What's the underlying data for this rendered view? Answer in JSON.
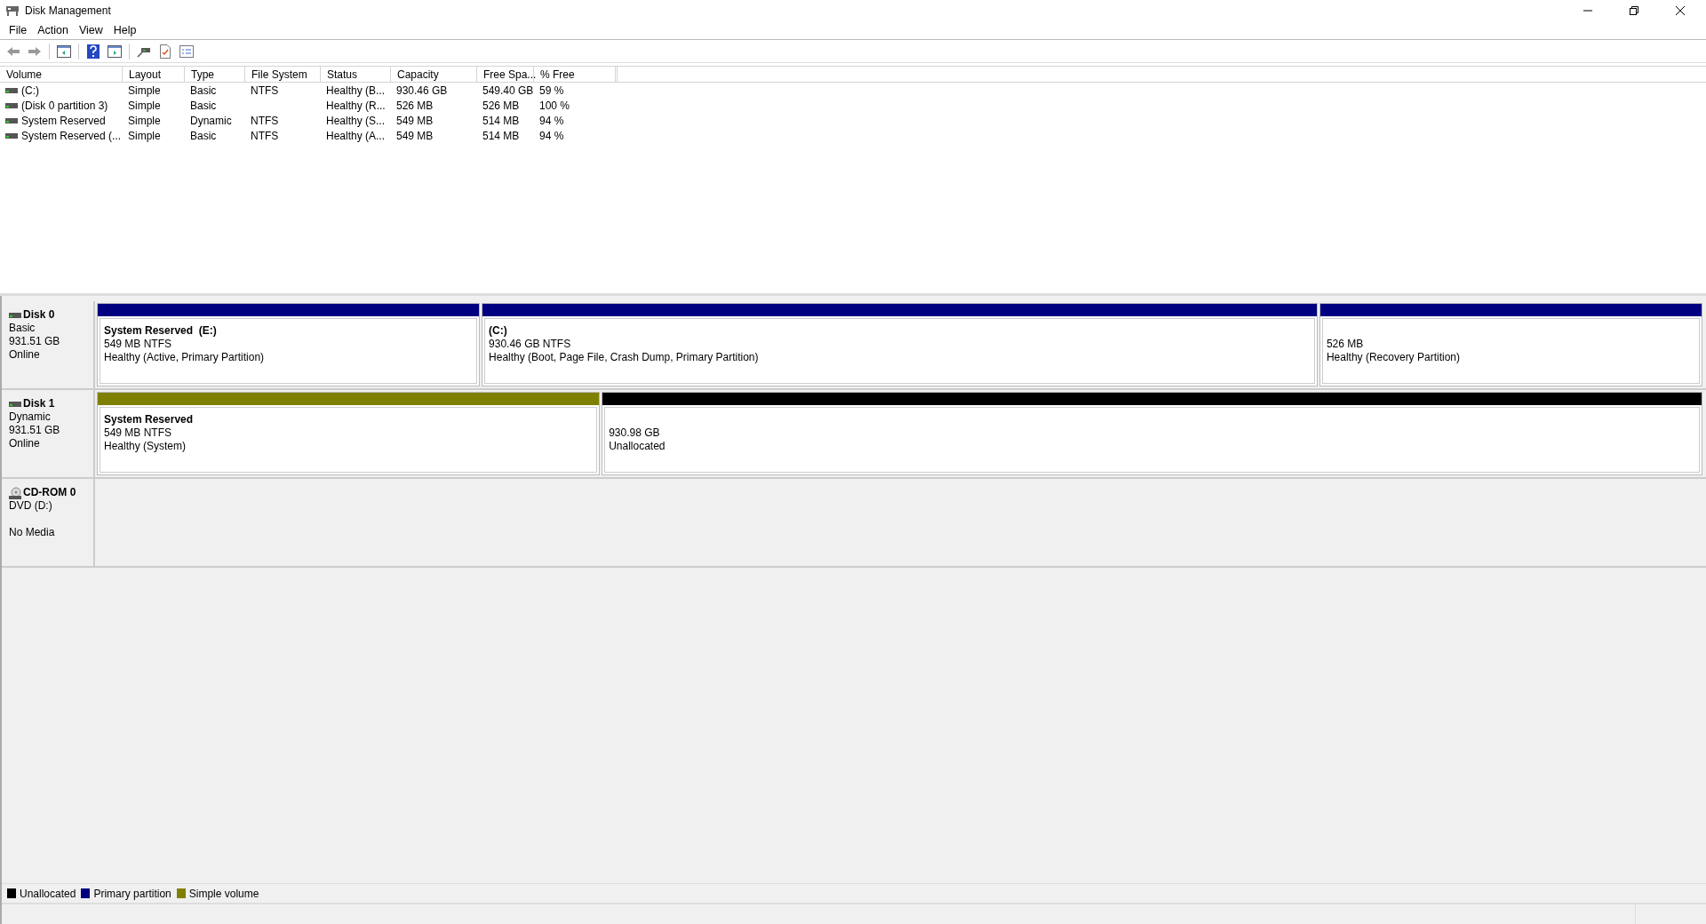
{
  "window": {
    "title": "Disk Management"
  },
  "menu": [
    "File",
    "Action",
    "View",
    "Help"
  ],
  "table": {
    "columns": [
      "Volume",
      "Layout",
      "Type",
      "File System",
      "Status",
      "Capacity",
      "Free Spa...",
      "% Free"
    ],
    "rows": [
      {
        "cells": [
          "(C:)",
          "Simple",
          "Basic",
          "NTFS",
          "Healthy (B...",
          "930.46 GB",
          "549.40 GB",
          "59 %"
        ]
      },
      {
        "cells": [
          "(Disk 0 partition 3)",
          "Simple",
          "Basic",
          "",
          "Healthy (R...",
          "526 MB",
          "526 MB",
          "100 %"
        ]
      },
      {
        "cells": [
          "System Reserved",
          "Simple",
          "Dynamic",
          "NTFS",
          "Healthy (S...",
          "549 MB",
          "514 MB",
          "94 %"
        ]
      },
      {
        "cells": [
          "System Reserved (...",
          "Simple",
          "Basic",
          "NTFS",
          "Healthy (A...",
          "549 MB",
          "514 MB",
          "94 %"
        ]
      }
    ]
  },
  "disks": [
    {
      "kind": "disk",
      "name": "Disk 0",
      "lines": [
        "Basic",
        "931.51 GB",
        "Online"
      ],
      "partitions": [
        {
          "kind": "primary",
          "title": "System Reserved  (E:)",
          "size": "549 MB NTFS",
          "status": "Healthy (Active, Primary Partition)"
        },
        {
          "kind": "primary",
          "title": "(C:)",
          "size": "930.46 GB NTFS",
          "status": "Healthy (Boot, Page File, Crash Dump, Primary Partition)"
        },
        {
          "kind": "primary",
          "size": "526 MB",
          "status": "Healthy (Recovery Partition)"
        }
      ]
    },
    {
      "kind": "disk",
      "name": "Disk 1",
      "lines": [
        "Dynamic",
        "931.51 GB",
        "Online"
      ],
      "partitions": [
        {
          "kind": "simple",
          "title": "System Reserved",
          "size": "549 MB NTFS",
          "status": "Healthy (System)"
        },
        {
          "kind": "unallocated",
          "size": "930.98 GB",
          "status": "Unallocated"
        }
      ]
    },
    {
      "kind": "cdrom",
      "name": "CD-ROM 0",
      "lines": [
        "DVD (D:)"
      ],
      "media": "No Media"
    }
  ],
  "legend": [
    {
      "label": "Unallocated",
      "color": "#000000"
    },
    {
      "label": "Primary partition",
      "color": "#000080"
    },
    {
      "label": "Simple volume",
      "color": "#808000"
    }
  ]
}
